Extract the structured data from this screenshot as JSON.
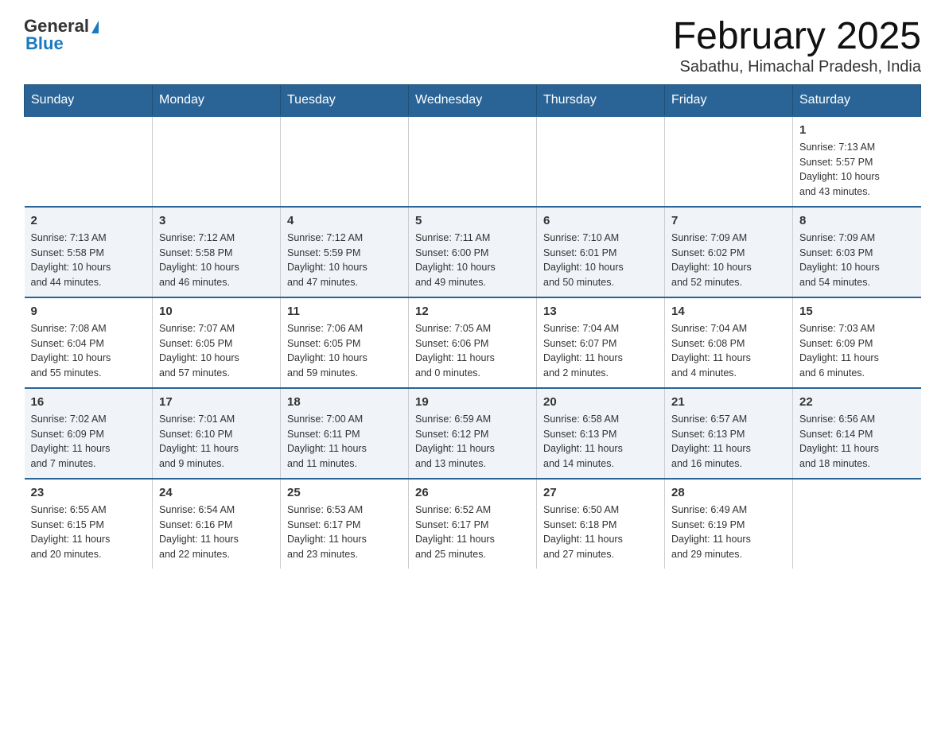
{
  "header": {
    "logo_general": "General",
    "logo_blue": "Blue",
    "title": "February 2025",
    "subtitle": "Sabathu, Himachal Pradesh, India"
  },
  "days_of_week": [
    "Sunday",
    "Monday",
    "Tuesday",
    "Wednesday",
    "Thursday",
    "Friday",
    "Saturday"
  ],
  "weeks": [
    {
      "days": [
        {
          "number": "",
          "info": ""
        },
        {
          "number": "",
          "info": ""
        },
        {
          "number": "",
          "info": ""
        },
        {
          "number": "",
          "info": ""
        },
        {
          "number": "",
          "info": ""
        },
        {
          "number": "",
          "info": ""
        },
        {
          "number": "1",
          "info": "Sunrise: 7:13 AM\nSunset: 5:57 PM\nDaylight: 10 hours\nand 43 minutes."
        }
      ]
    },
    {
      "days": [
        {
          "number": "2",
          "info": "Sunrise: 7:13 AM\nSunset: 5:58 PM\nDaylight: 10 hours\nand 44 minutes."
        },
        {
          "number": "3",
          "info": "Sunrise: 7:12 AM\nSunset: 5:58 PM\nDaylight: 10 hours\nand 46 minutes."
        },
        {
          "number": "4",
          "info": "Sunrise: 7:12 AM\nSunset: 5:59 PM\nDaylight: 10 hours\nand 47 minutes."
        },
        {
          "number": "5",
          "info": "Sunrise: 7:11 AM\nSunset: 6:00 PM\nDaylight: 10 hours\nand 49 minutes."
        },
        {
          "number": "6",
          "info": "Sunrise: 7:10 AM\nSunset: 6:01 PM\nDaylight: 10 hours\nand 50 minutes."
        },
        {
          "number": "7",
          "info": "Sunrise: 7:09 AM\nSunset: 6:02 PM\nDaylight: 10 hours\nand 52 minutes."
        },
        {
          "number": "8",
          "info": "Sunrise: 7:09 AM\nSunset: 6:03 PM\nDaylight: 10 hours\nand 54 minutes."
        }
      ]
    },
    {
      "days": [
        {
          "number": "9",
          "info": "Sunrise: 7:08 AM\nSunset: 6:04 PM\nDaylight: 10 hours\nand 55 minutes."
        },
        {
          "number": "10",
          "info": "Sunrise: 7:07 AM\nSunset: 6:05 PM\nDaylight: 10 hours\nand 57 minutes."
        },
        {
          "number": "11",
          "info": "Sunrise: 7:06 AM\nSunset: 6:05 PM\nDaylight: 10 hours\nand 59 minutes."
        },
        {
          "number": "12",
          "info": "Sunrise: 7:05 AM\nSunset: 6:06 PM\nDaylight: 11 hours\nand 0 minutes."
        },
        {
          "number": "13",
          "info": "Sunrise: 7:04 AM\nSunset: 6:07 PM\nDaylight: 11 hours\nand 2 minutes."
        },
        {
          "number": "14",
          "info": "Sunrise: 7:04 AM\nSunset: 6:08 PM\nDaylight: 11 hours\nand 4 minutes."
        },
        {
          "number": "15",
          "info": "Sunrise: 7:03 AM\nSunset: 6:09 PM\nDaylight: 11 hours\nand 6 minutes."
        }
      ]
    },
    {
      "days": [
        {
          "number": "16",
          "info": "Sunrise: 7:02 AM\nSunset: 6:09 PM\nDaylight: 11 hours\nand 7 minutes."
        },
        {
          "number": "17",
          "info": "Sunrise: 7:01 AM\nSunset: 6:10 PM\nDaylight: 11 hours\nand 9 minutes."
        },
        {
          "number": "18",
          "info": "Sunrise: 7:00 AM\nSunset: 6:11 PM\nDaylight: 11 hours\nand 11 minutes."
        },
        {
          "number": "19",
          "info": "Sunrise: 6:59 AM\nSunset: 6:12 PM\nDaylight: 11 hours\nand 13 minutes."
        },
        {
          "number": "20",
          "info": "Sunrise: 6:58 AM\nSunset: 6:13 PM\nDaylight: 11 hours\nand 14 minutes."
        },
        {
          "number": "21",
          "info": "Sunrise: 6:57 AM\nSunset: 6:13 PM\nDaylight: 11 hours\nand 16 minutes."
        },
        {
          "number": "22",
          "info": "Sunrise: 6:56 AM\nSunset: 6:14 PM\nDaylight: 11 hours\nand 18 minutes."
        }
      ]
    },
    {
      "days": [
        {
          "number": "23",
          "info": "Sunrise: 6:55 AM\nSunset: 6:15 PM\nDaylight: 11 hours\nand 20 minutes."
        },
        {
          "number": "24",
          "info": "Sunrise: 6:54 AM\nSunset: 6:16 PM\nDaylight: 11 hours\nand 22 minutes."
        },
        {
          "number": "25",
          "info": "Sunrise: 6:53 AM\nSunset: 6:17 PM\nDaylight: 11 hours\nand 23 minutes."
        },
        {
          "number": "26",
          "info": "Sunrise: 6:52 AM\nSunset: 6:17 PM\nDaylight: 11 hours\nand 25 minutes."
        },
        {
          "number": "27",
          "info": "Sunrise: 6:50 AM\nSunset: 6:18 PM\nDaylight: 11 hours\nand 27 minutes."
        },
        {
          "number": "28",
          "info": "Sunrise: 6:49 AM\nSunset: 6:19 PM\nDaylight: 11 hours\nand 29 minutes."
        },
        {
          "number": "",
          "info": ""
        }
      ]
    }
  ]
}
